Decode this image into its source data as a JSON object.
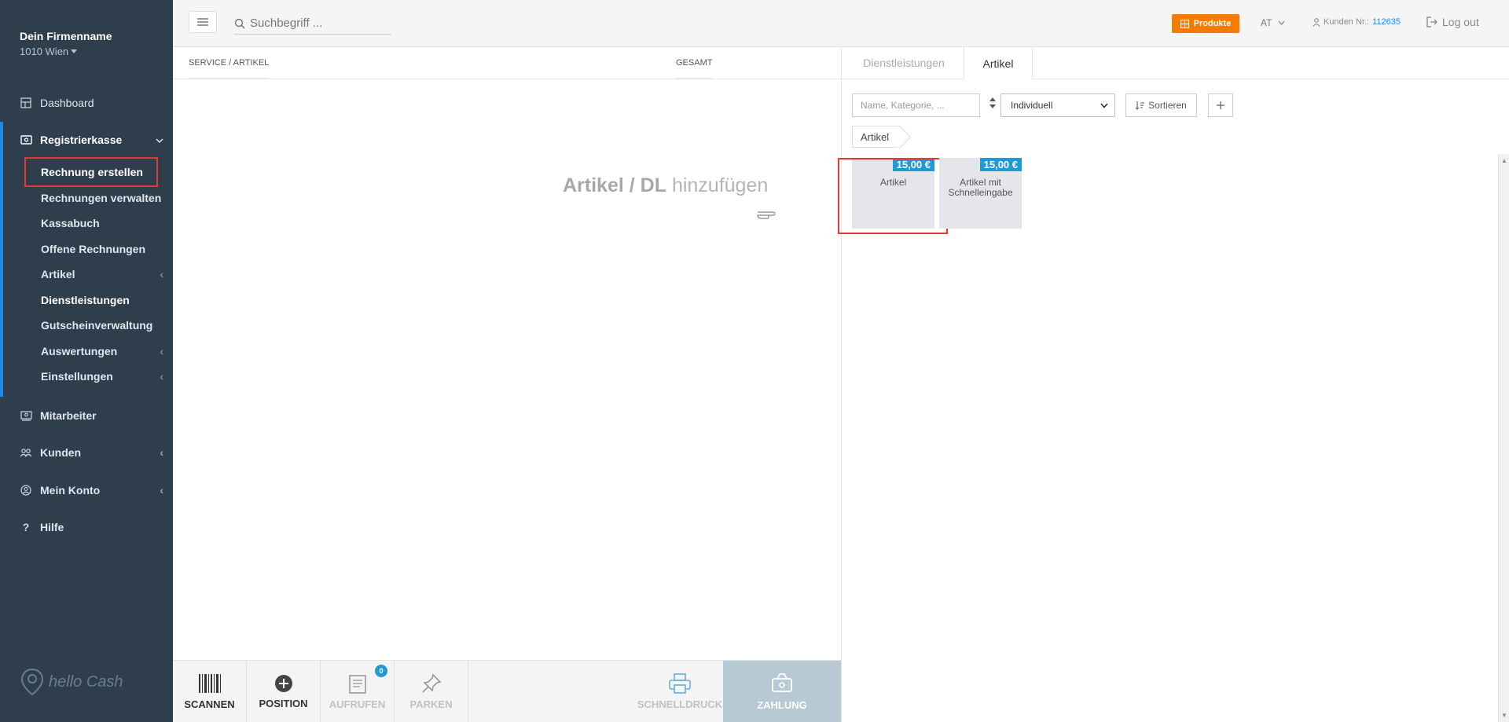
{
  "sidebar": {
    "company_name": "Dein Firmenname",
    "company_city": "1010 Wien",
    "nav": [
      {
        "label": "Dashboard",
        "icon": "dashboard-icon"
      },
      {
        "label": "Registrierkasse",
        "icon": "cash-register-icon"
      },
      {
        "label": "Mitarbeiter",
        "icon": "employees-icon"
      },
      {
        "label": "Kunden",
        "icon": "customers-icon"
      },
      {
        "label": "Mein Konto",
        "icon": "account-icon"
      },
      {
        "label": "Hilfe",
        "icon": "help-icon"
      }
    ],
    "sub": [
      {
        "label": "Rechnung erstellen"
      },
      {
        "label": "Rechnungen verwalten"
      },
      {
        "label": "Kassabuch"
      },
      {
        "label": "Offene Rechnungen"
      },
      {
        "label": "Artikel"
      },
      {
        "label": "Dienstleistungen"
      },
      {
        "label": "Gutscheinverwaltung"
      },
      {
        "label": "Auswertungen"
      },
      {
        "label": "Einstellungen"
      }
    ],
    "logo_text": "hello Cash"
  },
  "topbar": {
    "search_placeholder": "Suchbegriff ...",
    "produkte": "Produkte",
    "lang": "AT",
    "kunden_label": "Kunden Nr.:",
    "kunden_nr": "112635",
    "logout": "Log out",
    "accent": "#f57c00"
  },
  "cart": {
    "col_service": "SERVICE / ARTIKEL",
    "col_gesamt": "GESAMT",
    "hint_bold": "Artikel / DL",
    "hint_rest": "hinzufügen"
  },
  "catalog": {
    "tab_dl": "Dienstleistungen",
    "tab_art": "Artikel",
    "filter_placeholder": "Name, Kategorie, ...",
    "select_value": "Individuell",
    "sort_label": "Sortieren",
    "breadcrumb": "Artikel",
    "tiles": [
      {
        "price": "15,00 €",
        "label": "Artikel"
      },
      {
        "price": "15,00 €",
        "label": "Artikel mit Schnelleingabe"
      }
    ]
  },
  "bottombar": {
    "scannen": "SCANNEN",
    "position": "POSITION",
    "aufrufen": "AUFRUFEN",
    "aufrufen_badge": "0",
    "parken": "PARKEN",
    "schnelldruck": "SCHNELLDRUCK",
    "zahlung": "ZAHLUNG"
  }
}
